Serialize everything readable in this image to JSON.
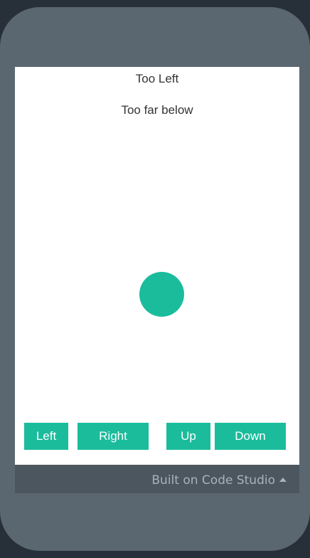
{
  "app": {
    "horizontal_status": "Too Left",
    "vertical_status": "Too far below"
  },
  "controls": {
    "left_label": "Left",
    "right_label": "Right",
    "up_label": "Up",
    "down_label": "Down"
  },
  "footer": {
    "built_on": "Built on Code Studio"
  },
  "colors": {
    "accent": "#1abc9c",
    "frame": "#5b6770",
    "footer": "#4c565f",
    "background": "#273038"
  },
  "icons": {
    "footer_caret": "caret-up-icon",
    "ball": "circle"
  }
}
